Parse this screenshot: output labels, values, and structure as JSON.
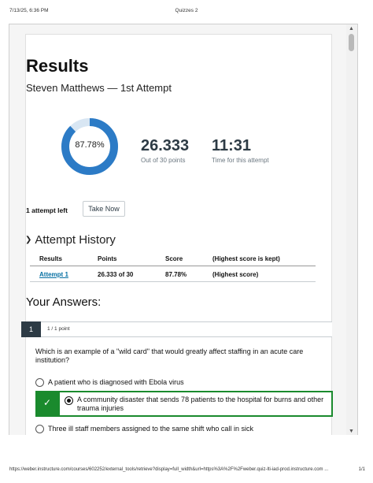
{
  "print_header": {
    "datetime": "7/13/25, 6:36 PM",
    "title": "Quizzes 2"
  },
  "print_footer": {
    "url": "https://weber.instructure.com/courses/602252/external_tools/retrieve?display=full_width&url=https%3A%2F%2Fweber.quiz-lti-iad-prod.instructure.com ...",
    "page": "1/1"
  },
  "results": {
    "title": "Results",
    "subtitle": "Steven Matthews — 1st Attempt",
    "percent_label": "87.78%",
    "percent_value": 0.8778,
    "ring_color": "#2c7bc6",
    "ring_track_color": "#d8e6f3",
    "score": "26.333",
    "score_caption": "Out of 30 points",
    "time": "11:31",
    "time_caption": "Time for this attempt"
  },
  "attempts": {
    "left_label": "1 attempt left",
    "take_now_label": "Take Now"
  },
  "history": {
    "heading": "Attempt History",
    "columns": [
      "Results",
      "Points",
      "Score",
      "(Highest score is kept)"
    ],
    "rows": [
      {
        "result": "Attempt 1",
        "points": "26.333 of 30",
        "score": "87.78%",
        "note": "(Highest score)"
      }
    ]
  },
  "answers": {
    "heading": "Your Answers:",
    "question": {
      "number": "1",
      "points": "1 / 1 point",
      "text": "Which is an example of a \"wild card\" that would greatly affect staffing in an acute care institution?",
      "options": [
        {
          "text": "A patient who is diagnosed with Ebola virus",
          "selected": false,
          "correct": false
        },
        {
          "text": "A community disaster that sends 78 patients to the hospital for burns and other trauma injuries",
          "selected": true,
          "correct": true
        },
        {
          "text": "Three ill staff members assigned to the same shift who call in sick",
          "selected": false,
          "correct": false
        }
      ],
      "correct_color": "#1a8a2d"
    }
  },
  "icons": {
    "chevron": "chevron-down-icon",
    "check": "check-icon"
  }
}
